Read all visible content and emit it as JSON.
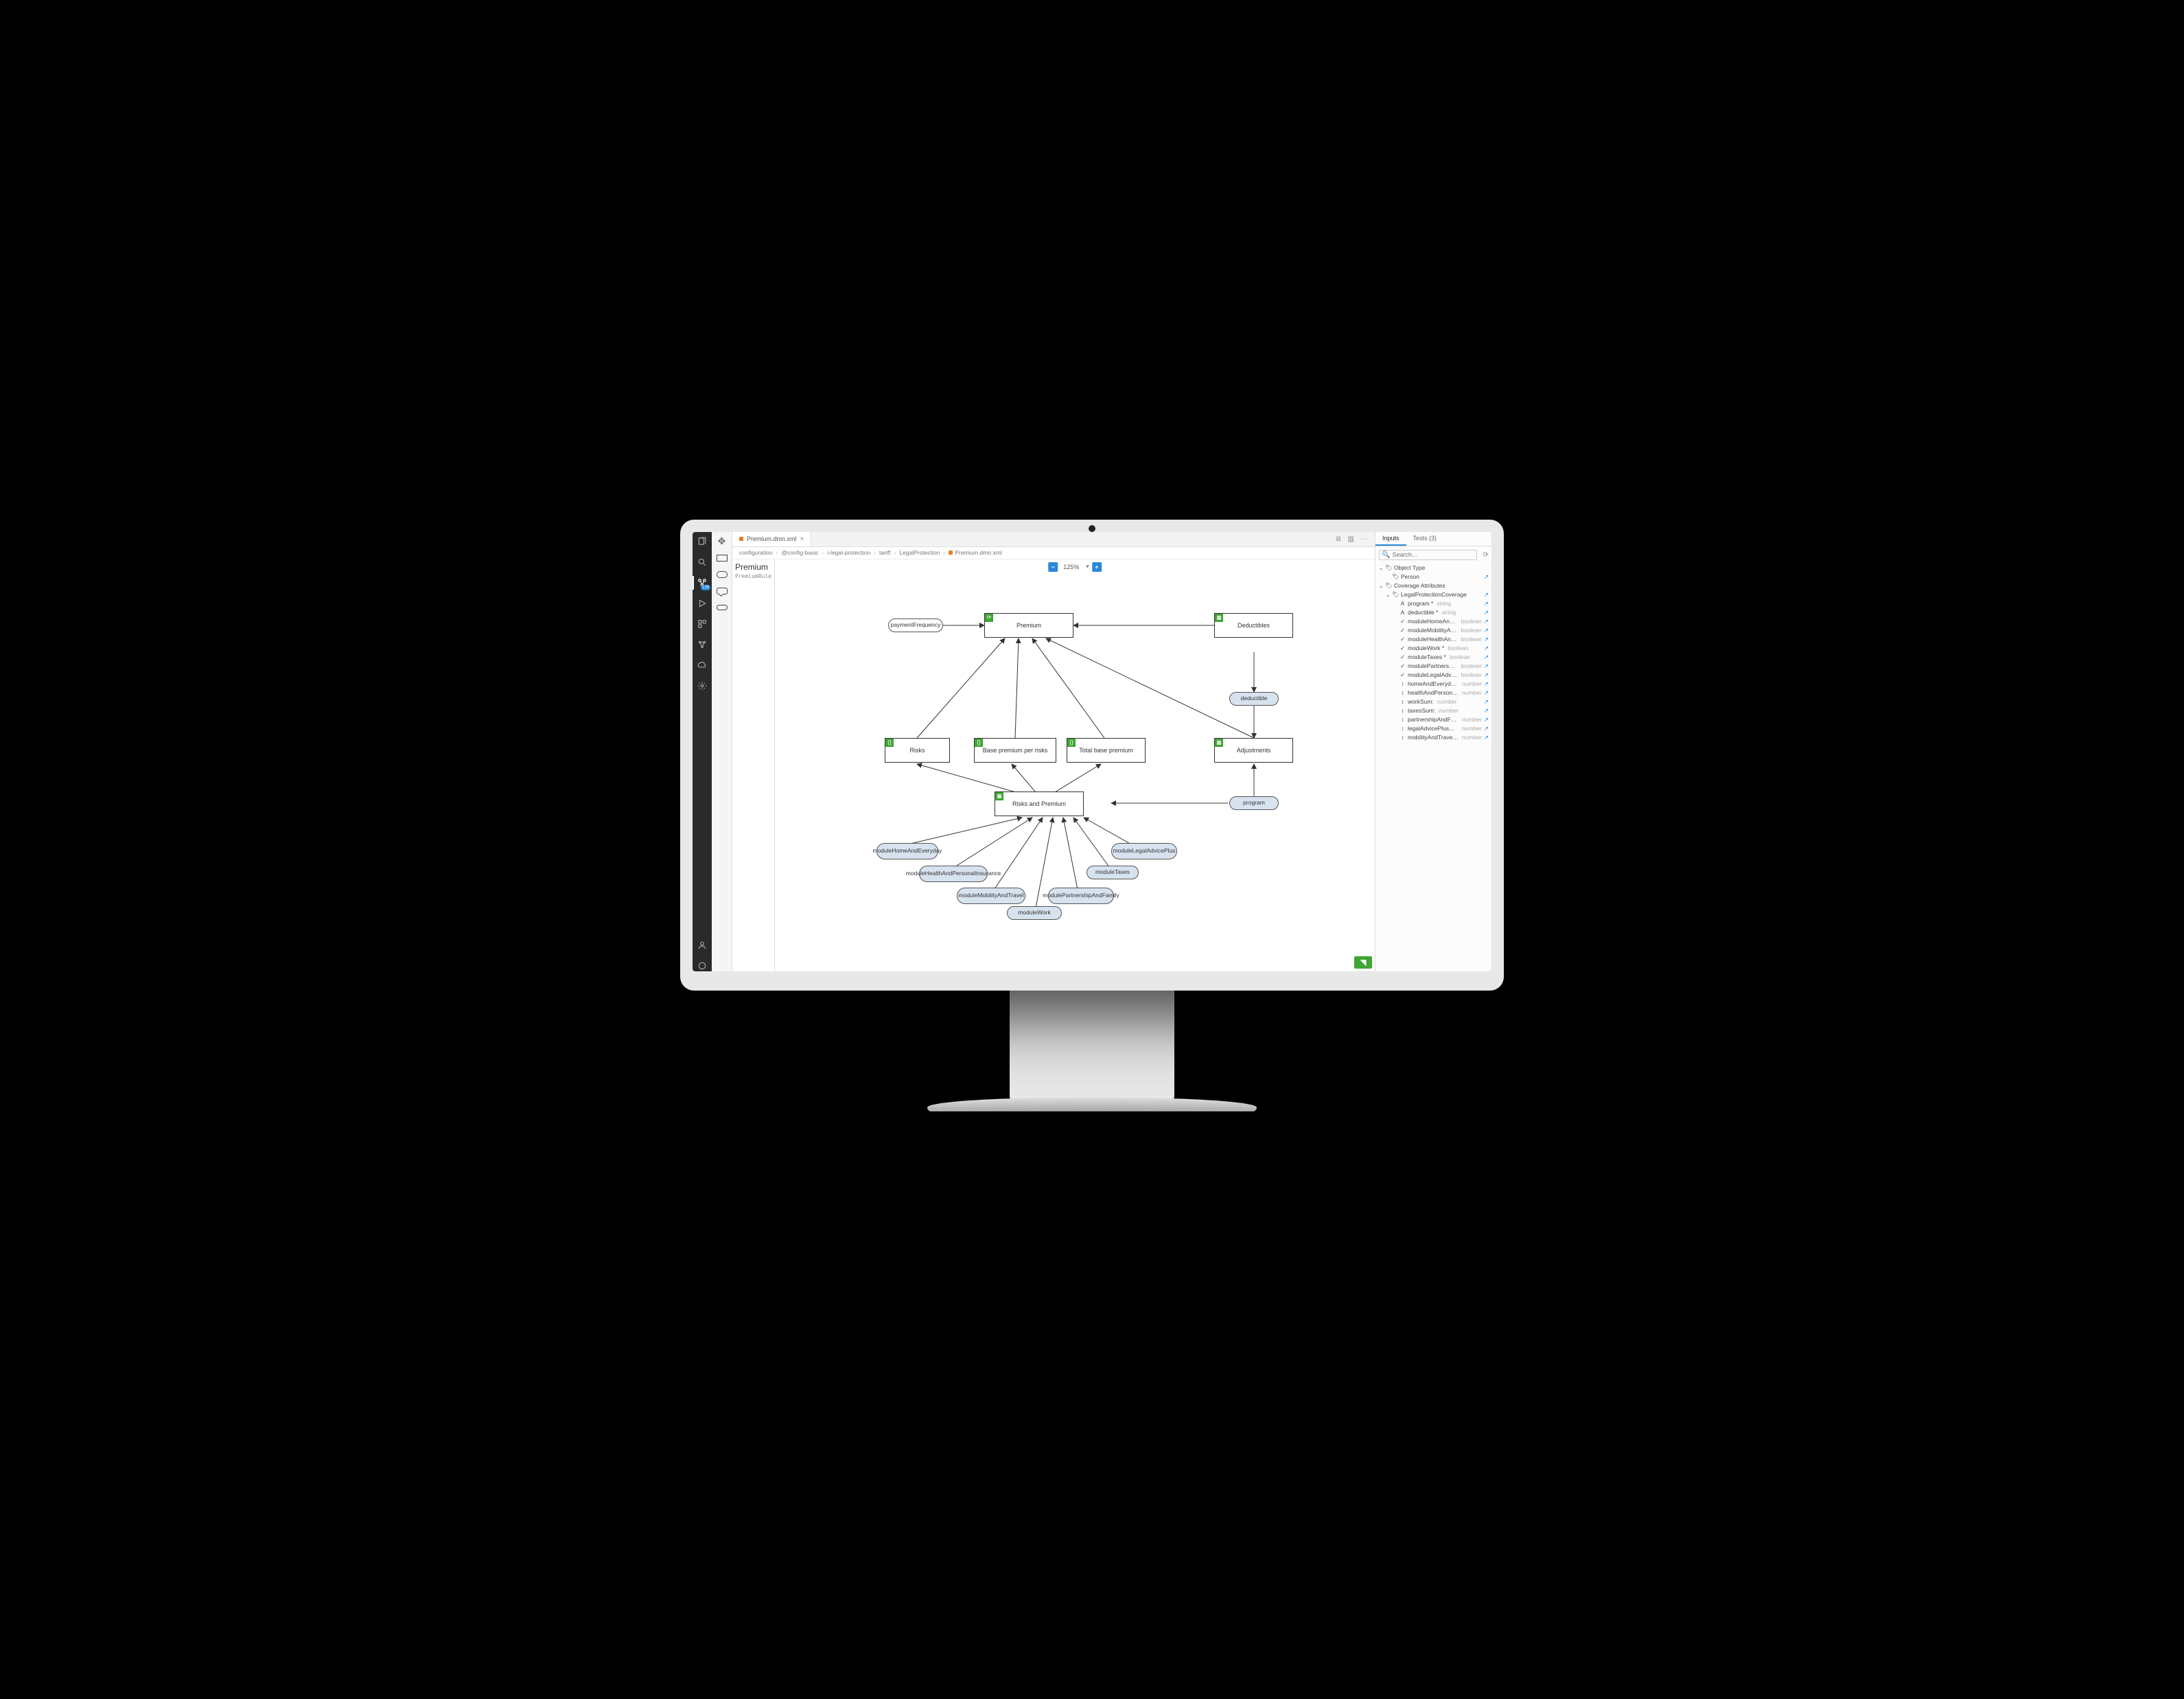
{
  "tab": {
    "filename": "Premium.dmn.xml"
  },
  "breadcrumb": [
    "configuration",
    "@config-basic",
    "i-legal-protection",
    "tariff",
    "LegalProtection",
    "Premium.dmn.xml"
  ],
  "zoom": {
    "value": "125%"
  },
  "sideLabel": {
    "title": "Premium",
    "subtitle": "PremiumRule"
  },
  "nodes": {
    "premium": "Premium",
    "deductibles": "Deductibles",
    "risks": "Risks",
    "baseRisk": "Base premium per risks",
    "totalBase": "Total base premium",
    "adjustments": "Adjustments",
    "risksPremium": "Risks and Premium"
  },
  "pills": {
    "paymentFrequency": "paymentFrequency",
    "deductible": "deductible",
    "program": "program",
    "moduleHome": "moduleHomeAndEveryday",
    "moduleHealth": "moduleHealthAndPersonalInsurance",
    "moduleMobility": "moduleMobilityAndTravel",
    "moduleWork": "moduleWork",
    "modulePartnership": "modulePartnershipAndFamily",
    "moduleTaxes": "moduleTaxes",
    "moduleLegal": "moduleLegalAdvicePlus"
  },
  "rightPanel": {
    "tabs": {
      "inputs": "Inputs",
      "tests": "Tests (3)"
    },
    "searchPlaceholder": "Search...",
    "tree": {
      "objectType": "Object Type",
      "person": "Person",
      "coverageAttrs": "Coverage Attributes",
      "legalCoverage": "LegalProtectionCoverage",
      "rows": [
        {
          "icon": "A",
          "label": "program *",
          "type": "string"
        },
        {
          "icon": "A",
          "label": "deductible *",
          "type": "string"
        },
        {
          "icon": "✓",
          "label": "moduleHomeAndEve…",
          "type": "boolean"
        },
        {
          "icon": "✓",
          "label": "moduleMobilityAndT…",
          "type": "boolean"
        },
        {
          "icon": "✓",
          "label": "moduleHealthAndPe…",
          "type": "boolean"
        },
        {
          "icon": "✓",
          "label": "moduleWork *",
          "type": "boolean"
        },
        {
          "icon": "✓",
          "label": "moduleTaxes *",
          "type": "boolean"
        },
        {
          "icon": "✓",
          "label": "modulePartnershipA…",
          "type": "boolean"
        },
        {
          "icon": "✓",
          "label": "moduleLegalAdviceP…",
          "type": "boolean"
        },
        {
          "icon": "↕",
          "label": "homeAndEverydayS…:",
          "type": "number"
        },
        {
          "icon": "↕",
          "label": "healthAndPersonalIn…:",
          "type": "number"
        },
        {
          "icon": "↕",
          "label": "workSum:",
          "type": "number"
        },
        {
          "icon": "↕",
          "label": "taxesSum:",
          "type": "number"
        },
        {
          "icon": "↕",
          "label": "partnershipAndFamil…:",
          "type": "number"
        },
        {
          "icon": "↕",
          "label": "legalAdvicePlusSum:",
          "type": "number"
        },
        {
          "icon": "↕",
          "label": "mobilityAndTravelSum:",
          "type": "number"
        }
      ]
    }
  },
  "activityBadge": "129"
}
